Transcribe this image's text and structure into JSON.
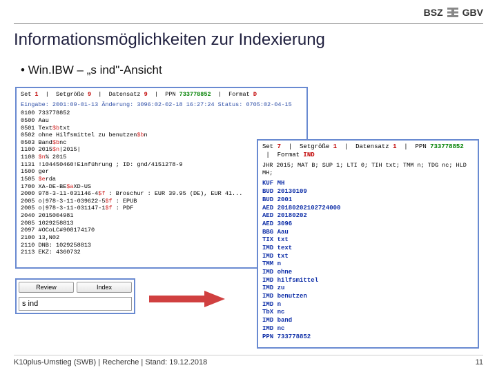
{
  "header": {
    "org1": "BSZ",
    "org2": "GBV"
  },
  "title": "Informationsmöglichkeiten zur Indexierung",
  "bullet1": "Win.IBW – „s ind\"-Ansicht",
  "panelD": {
    "hdr_set_lbl": "Set",
    "hdr_set": "1",
    "hdr_size_lbl": "Setgröße",
    "hdr_size": "9",
    "hdr_rec_lbl": "Datensatz",
    "hdr_rec": "9",
    "hdr_ppn_lbl": "PPN",
    "hdr_ppn": "733778852",
    "hdr_fmt_lbl": "Format",
    "hdr_fmt": "D",
    "meta": "Eingabe: 2001:09-01-13 Änderung: 3096:02-02-18 16:27:24 Status: 0705:02-04-15",
    "lines": [
      "0100 733778852",
      "0500 Aau",
      "0501 Text$btxt",
      "0502 ohne Hilfsmittel zu benutzen$bn",
      "0503 Band$bnc",
      "1100 2015$n|2015|",
      "1108 $n% 2015",
      "1131 !104450460!Einführung ; ID: gnd/4151278-9",
      "1500 ger",
      "1505 $erda",
      "1700 XA-DE-BE$aXD-US",
      "2000 978-3-11-031146-4$f : Broschur : EUR 39.95 (DE), EUR 41...",
      "2005 o|978-3-11-039622-5$f : EPUB",
      "2005 o|978-3-11-031147-1$f : PDF",
      "2040 2015004981",
      "2085 1029258813",
      "2097 #OCoLC#908174170",
      "2100 13,N02",
      "2110 DNB: 1029258813",
      "2113 EKZ: 4360732"
    ]
  },
  "panelIND": {
    "hdr_set_lbl": "Set",
    "hdr_set": "7",
    "hdr_size_lbl": "Setgröße",
    "hdr_size": "1",
    "hdr_rec_lbl": "Datensatz",
    "hdr_rec": "1",
    "hdr_ppn_lbl": "PPN",
    "hdr_ppn": "733778852",
    "hdr_fmt_lbl": "Format",
    "hdr_fmt": "IND",
    "jhdr": "JHR 2015; MAT B; SUP 1; LTI 0; TIH txt; TMM n; TDG nc; HLD MH;",
    "items": [
      "KUF MH",
      "BUD 20130109",
      "BUD 2001",
      "AED 20180202102724000",
      "AED 20180202",
      "AED 3096",
      "BBG Aau",
      "TIX txt",
      "IMD text",
      "IMD txt",
      "TMM n",
      "IMD ohne",
      "IMD hilfsmittel",
      "IMD zu",
      "IMD benutzen",
      "IMD n",
      "TbX nc",
      "IMD band",
      "IMD nc",
      "PPN 733778852"
    ]
  },
  "toolbar": {
    "btn1": "Review",
    "btn2": "Index",
    "cmd": "s ind"
  },
  "footer": {
    "left": "K10plus-Umstieg (SWB) | Recherche | Stand: 19.12.2018",
    "right": "11"
  }
}
